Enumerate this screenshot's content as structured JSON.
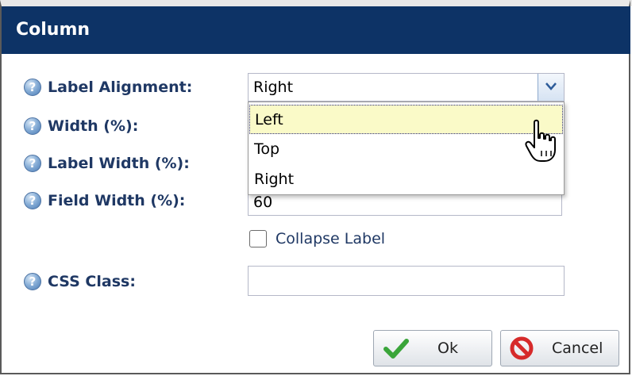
{
  "dialog": {
    "title": "Column"
  },
  "form": {
    "label_alignment": {
      "label": "Label Alignment:",
      "value": "Right",
      "options": [
        "Left",
        "Top",
        "Right"
      ],
      "highlighted_option": "Left"
    },
    "width": {
      "label": "Width (%):"
    },
    "label_width": {
      "label": "Label Width (%):"
    },
    "field_width": {
      "label": "Field Width (%):",
      "value": "60"
    },
    "collapse_label": {
      "label": "Collapse Label",
      "checked": false
    },
    "css_class": {
      "label": "CSS Class:",
      "value": ""
    }
  },
  "buttons": {
    "ok_label": "Ok",
    "cancel_label": "Cancel"
  },
  "icons": {
    "help": "help-icon",
    "ok": "checkmark-icon",
    "cancel": "no-entry-icon",
    "dropdown": "chevron-down-icon",
    "cursor": "hand-pointer-icon"
  },
  "colors": {
    "titlebar": "#0d3366",
    "label_text": "#1f3864",
    "selected_option_bg": "#fafac8"
  }
}
